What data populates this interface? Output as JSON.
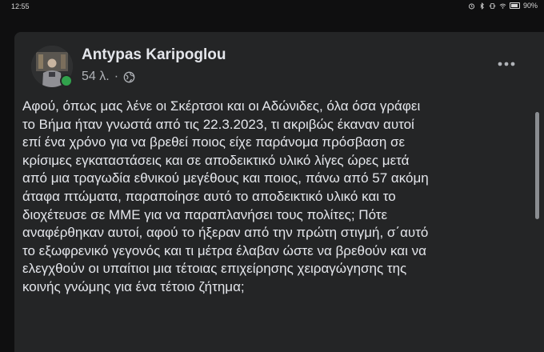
{
  "status_bar": {
    "time": "12:55",
    "battery": "90%"
  },
  "post": {
    "author": "Antypas Karipoglou",
    "time_ago": "54 λ.",
    "separator": "·",
    "privacy_icon": "globe-icon",
    "more_icon": "more-horizontal-icon",
    "online_color": "#31a24c",
    "lines": [
      "Αφού, όπως μας λένε οι Σκέρτσοι και οι Αδώνιδες, όλα όσα γράφει",
      "το Βήμα ήταν γνωστά από τις 22.3.2023, τι ακριβώς έκαναν αυτοί",
      "επί ένα χρόνο για να βρεθεί ποιος είχε παράνομα πρόσβαση σε",
      "κρίσιμες εγκαταστάσεις και σε αποδεικτικό υλικό λίγες ώρες μετά",
      "από μια τραγωδία εθνικού μεγέθους και ποιος, πάνω από 57 ακόμη",
      "άταφα πτώματα, παραποίησε αυτό το αποδεικτικό υλικό και το",
      "διοχέτευσε σε ΜΜΕ για να παραπλανήσει τους πολίτες; Πότε",
      "αναφέρθηκαν αυτοί, αφού το ήξεραν από την πρώτη στιγμή, σ΄αυτό",
      "το εξωφρενικό γεγονός και τι μέτρα έλαβαν ώστε να βρεθούν και να",
      "ελεγχθούν οι υπαίτιοι μια τέτοιας επιχείρησης χειραγώγησης της",
      "κοινής γνώμης για ένα τέτοιο ζήτημα;"
    ]
  }
}
